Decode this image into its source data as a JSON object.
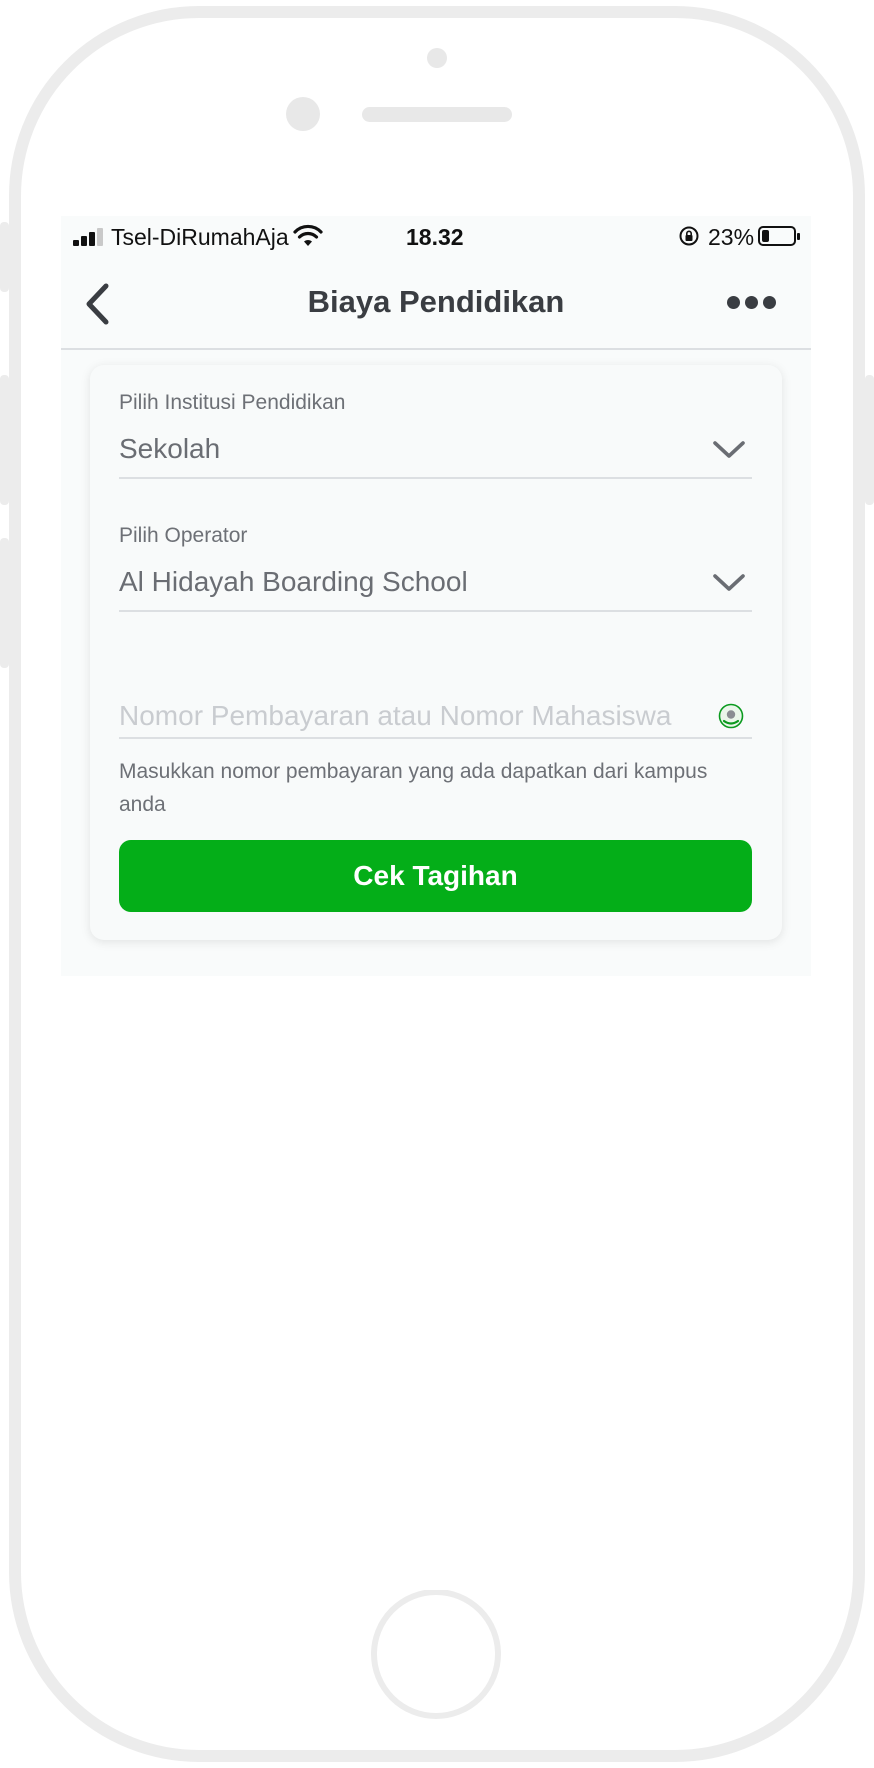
{
  "status_bar": {
    "carrier": "Tsel-DiRumahAja",
    "time": "18.32",
    "battery_percent": "23%",
    "battery_level": 0.23
  },
  "nav": {
    "title": "Biaya Pendidikan",
    "back_icon": "chevron-left-icon",
    "more_icon": "more-horizontal-icon"
  },
  "form": {
    "institution": {
      "label": "Pilih Institusi Pendidikan",
      "value": "Sekolah"
    },
    "operator": {
      "label": "Pilih Operator",
      "value": "Al Hidayah Boarding School"
    },
    "payment_number": {
      "placeholder": "Nomor Pembayaran atau Nomor Mahasiswa",
      "value": "",
      "helper": "Masukkan nomor pembayaran yang ada dapatkan dari kampus anda"
    },
    "submit_label": "Cek Tagihan"
  },
  "colors": {
    "accent": "#04ae18",
    "title_text": "#3a3d42",
    "muted_text": "#6d7076"
  }
}
